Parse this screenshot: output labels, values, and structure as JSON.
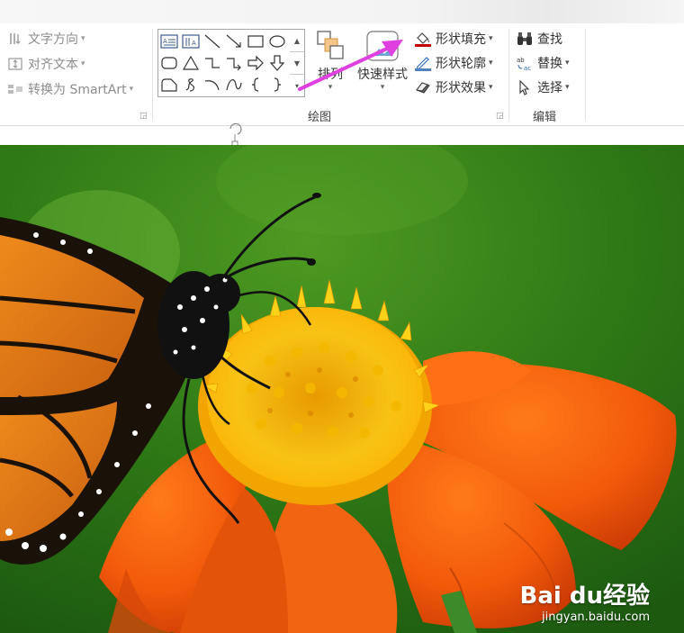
{
  "paragraph_group": {
    "text_direction": "文字方向",
    "align_text": "对齐文本",
    "convert_smartart": "转换为 SmartArt"
  },
  "drawing_group": {
    "label": "绘图",
    "arrange": "排列",
    "quick_styles": "快速样式",
    "shape_fill": "形状填充",
    "shape_outline": "形状轮廓",
    "shape_effects": "形状效果"
  },
  "editing_group": {
    "label": "编辑",
    "find": "查找",
    "replace": "替换",
    "select": "选择"
  },
  "watermark": {
    "logo": "Bai du经验",
    "url": "jingyan.baidu.com"
  },
  "colors": {
    "shape_fill_bar": "#c00000",
    "shape_outline_bar": "#4f81bd",
    "annotation_arrow": "#e040e0"
  }
}
